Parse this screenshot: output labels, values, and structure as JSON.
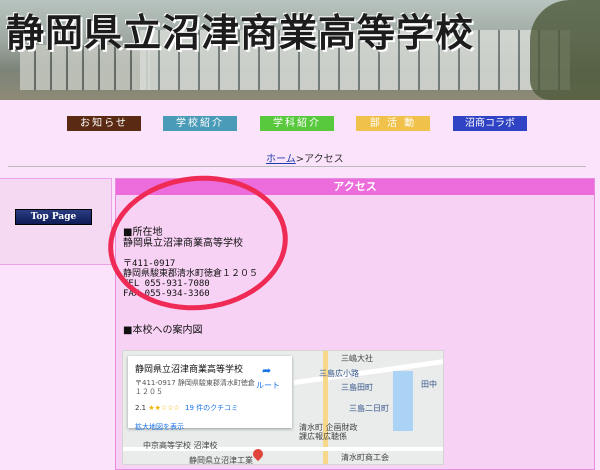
{
  "banner": {
    "title": "静岡県立沼津商業高等学校"
  },
  "nav": [
    {
      "label": "お知らせ",
      "color": "#5a2a12"
    },
    {
      "label": "学校紹介",
      "color": "#4a9bb8"
    },
    {
      "label": "学科紹介",
      "color": "#58c83c"
    },
    {
      "label": "部 活 動",
      "color": "#f1c24b"
    },
    {
      "label": "沼商コラボ",
      "color": "#2f43c4"
    }
  ],
  "breadcrumb": {
    "home": "ホーム",
    "separator": ">",
    "current": "アクセス"
  },
  "sidebar": {
    "top_page": "Top Page"
  },
  "main": {
    "heading": "アクセス",
    "location_heading": "■所在地",
    "school_name": "静岡県立沼津商業高等学校",
    "postal": "〒411-0917",
    "address": "静岡県駿東郡清水町徳倉１２０５",
    "tel": "TEL 055-931-7080",
    "fax": "FAX 055-934-3360",
    "map_heading": "■本校への案内図"
  },
  "map": {
    "card_title": "静岡県立沼津商業高等学校",
    "card_address": "〒411-0917 静岡県駿東郡清水町徳倉",
    "card_address2": "１２０５",
    "rating": "2.1",
    "stars": "★★☆☆☆",
    "reviews": "19 件のクチコミ",
    "route": "ルート",
    "larger_map": "拡大地図を表示",
    "labels": [
      {
        "text": "三嶋大社",
        "cls": "dark"
      },
      {
        "text": "三島広小路",
        "cls": ""
      },
      {
        "text": "三島田町",
        "cls": ""
      },
      {
        "text": "三島二日町",
        "cls": ""
      },
      {
        "text": "清水町 企画財政",
        "cls": "dark"
      },
      {
        "text": "課広報広聴係",
        "cls": "dark"
      },
      {
        "text": "中京高等学校 沼津校",
        "cls": "dark"
      },
      {
        "text": "静岡県立沼津工業",
        "cls": "dark"
      },
      {
        "text": "清水町商工会",
        "cls": "dark"
      },
      {
        "text": "田中",
        "cls": ""
      }
    ]
  }
}
